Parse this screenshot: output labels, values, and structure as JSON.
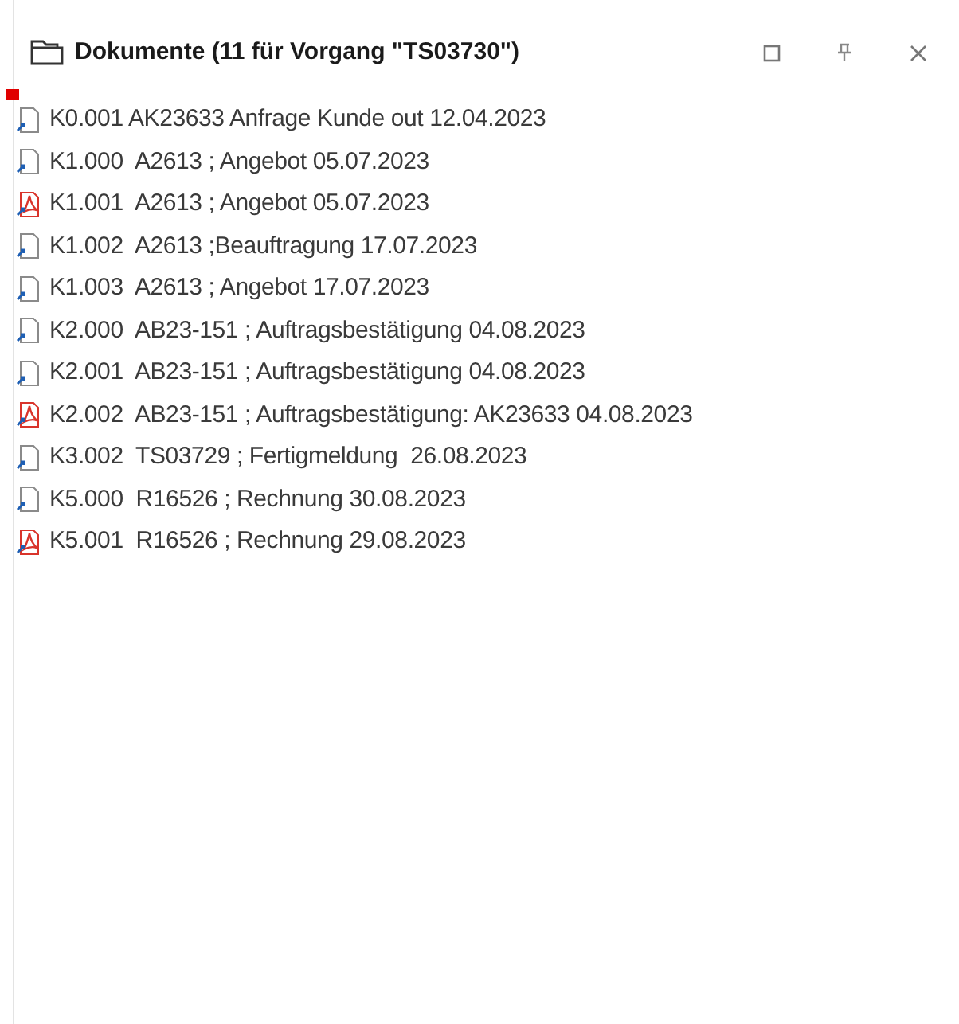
{
  "panel": {
    "title": "Dokumente (11 für Vorgang \"TS03730\")"
  },
  "documents": [
    {
      "kind": "file",
      "label": "K0.001 AK23633 Anfrage Kunde out 12.04.2023"
    },
    {
      "kind": "file",
      "label": "K1.000  A2613 ; Angebot 05.07.2023"
    },
    {
      "kind": "pdf",
      "label": "K1.001  A2613 ; Angebot 05.07.2023"
    },
    {
      "kind": "file",
      "label": "K1.002  A2613 ;Beauftragung 17.07.2023"
    },
    {
      "kind": "file",
      "label": "K1.003  A2613 ; Angebot 17.07.2023"
    },
    {
      "kind": "file",
      "label": "K2.000  AB23-151 ; Auftragsbestätigung 04.08.2023"
    },
    {
      "kind": "file",
      "label": "K2.001  AB23-151 ; Auftragsbestätigung 04.08.2023"
    },
    {
      "kind": "pdf",
      "label": "K2.002  AB23-151 ; Auftragsbestätigung: AK23633 04.08.2023"
    },
    {
      "kind": "file",
      "label": "K3.002  TS03729 ; Fertigmeldung  26.08.2023"
    },
    {
      "kind": "file",
      "label": "K5.000  R16526 ; Rechnung 30.08.2023"
    },
    {
      "kind": "pdf",
      "label": "K5.001  R16526 ; Rechnung 29.08.2023"
    }
  ]
}
